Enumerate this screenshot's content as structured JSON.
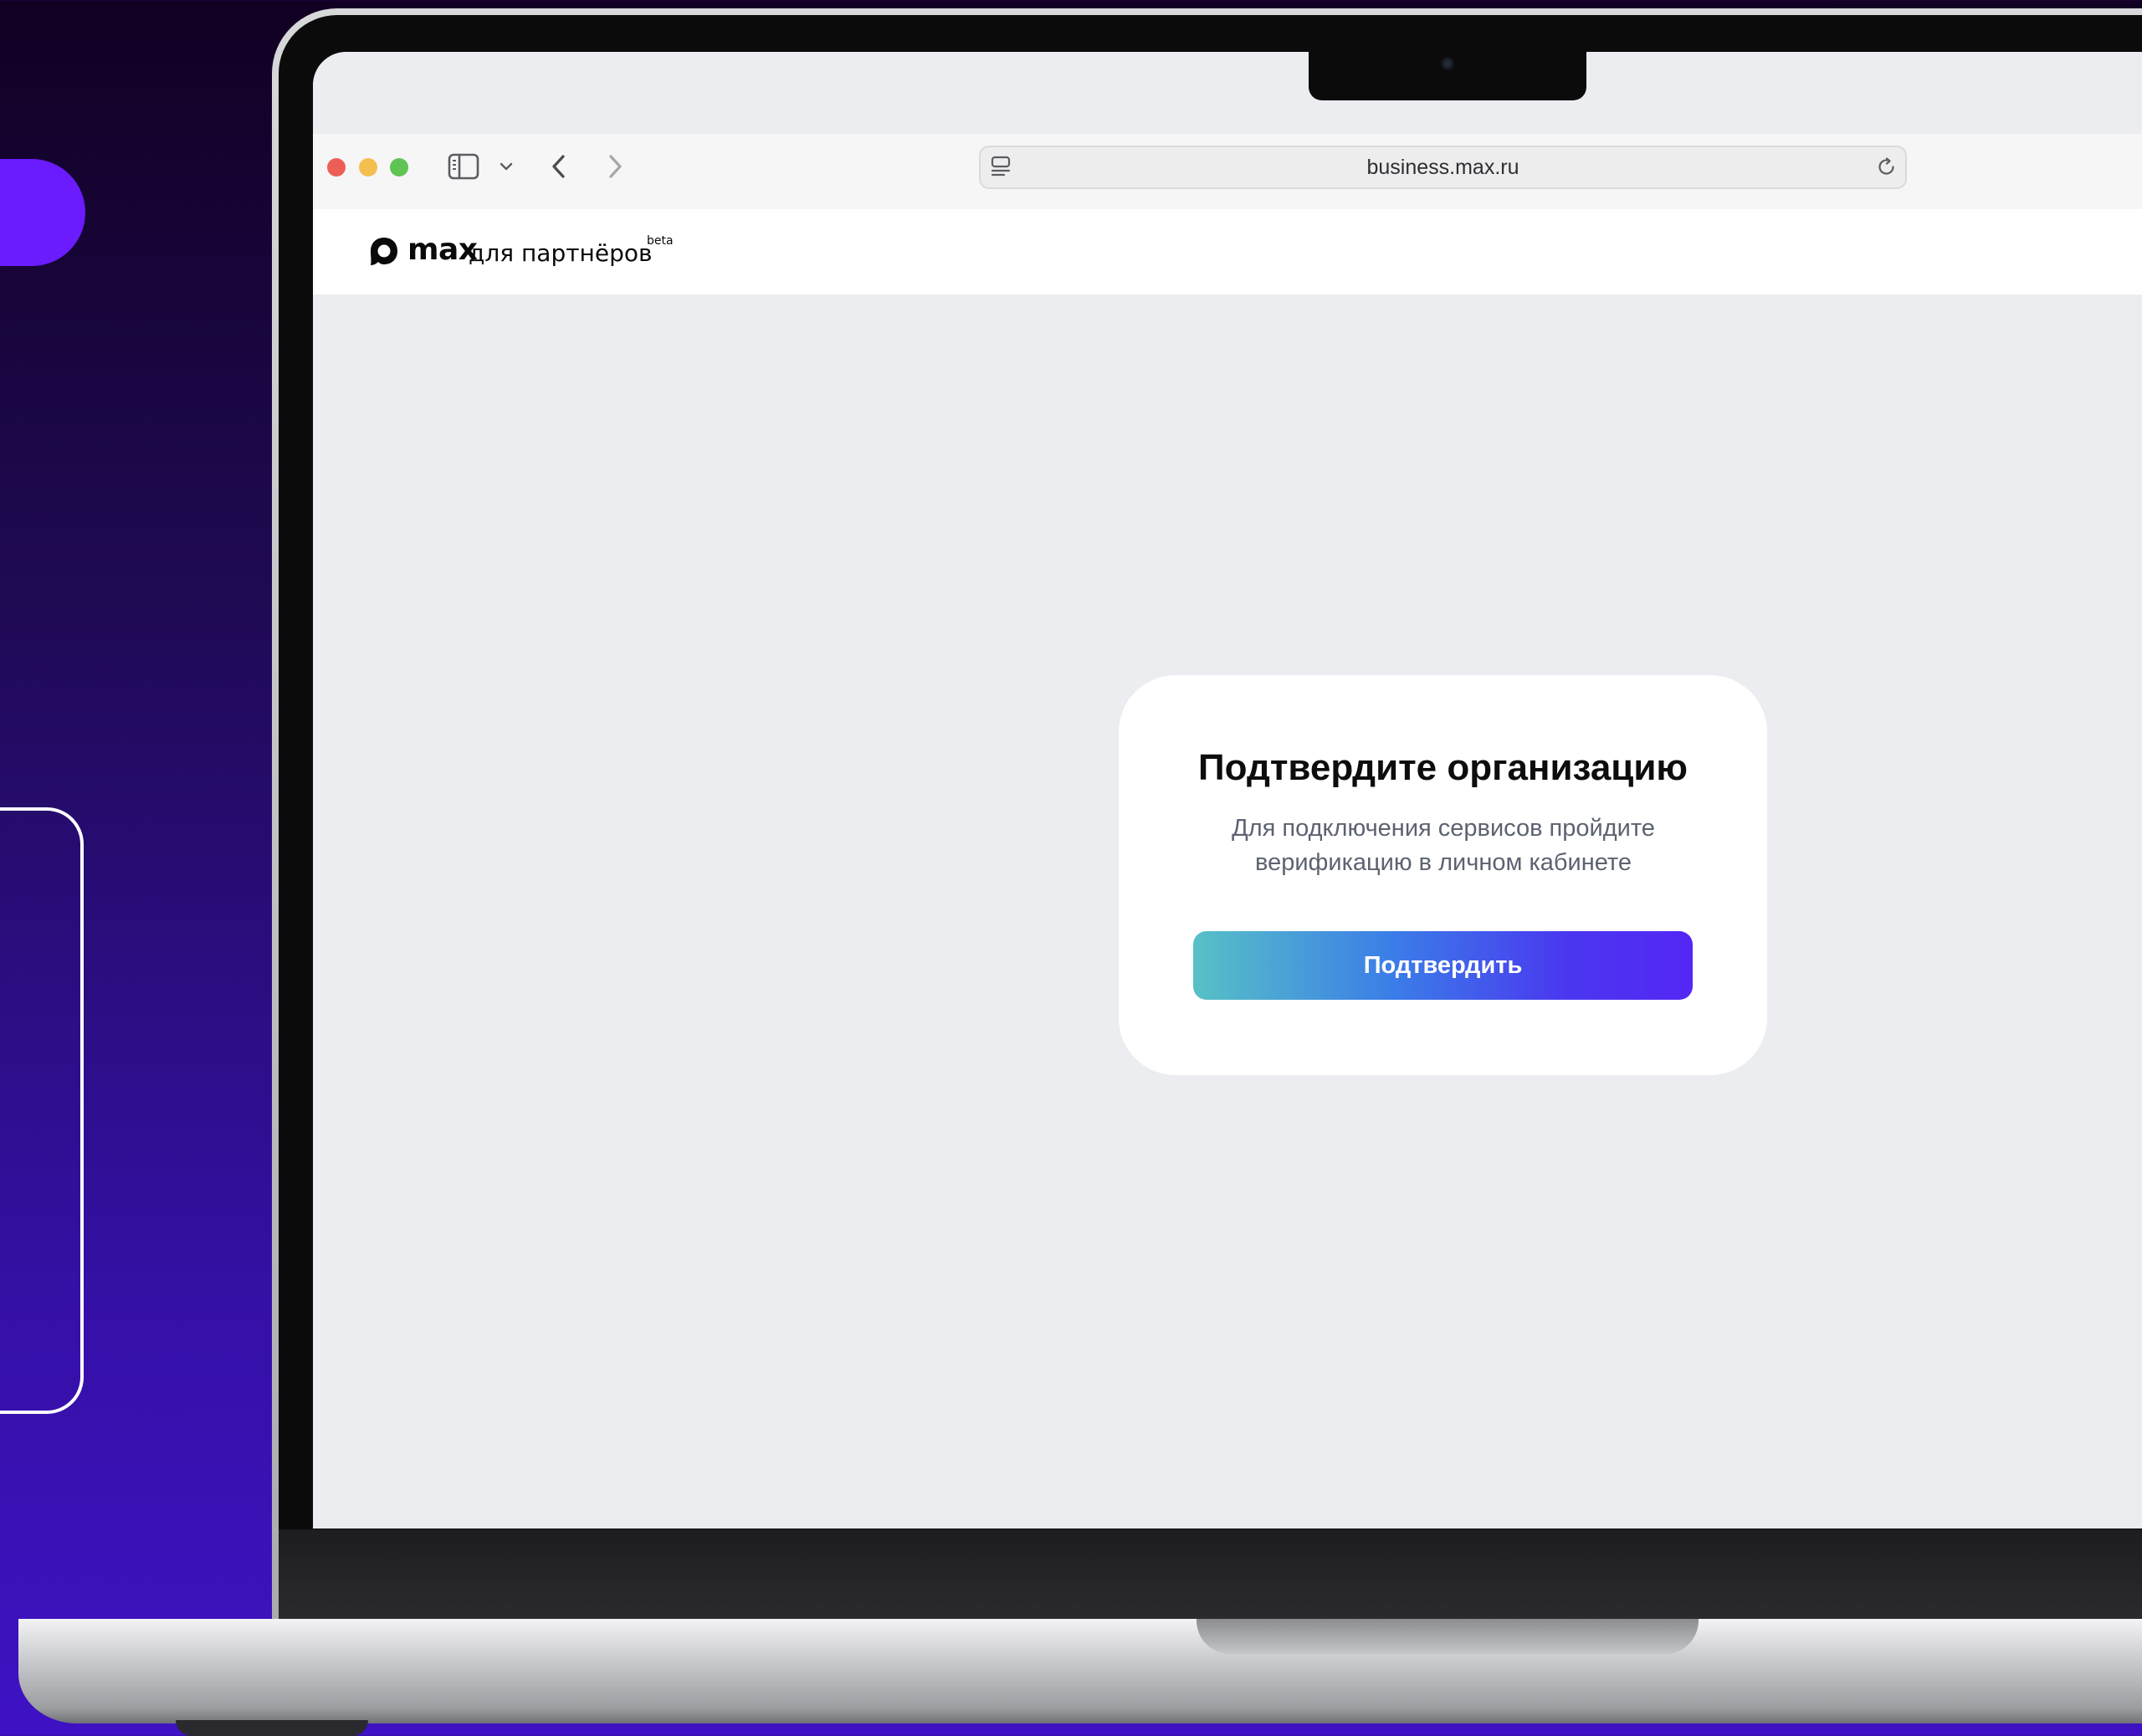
{
  "browser": {
    "url": "business.max.ru",
    "icons": {
      "sidebar": "sidebar-toggle-icon",
      "tab_overview": "chevron-down-icon",
      "back": "chevron-left-icon",
      "forward": "chevron-right-icon",
      "reader": "reader-mode-icon",
      "reload": "reload-icon"
    }
  },
  "site": {
    "logo": {
      "wordmark": "max",
      "subtitle": "для партнёров",
      "badge": "beta"
    }
  },
  "card": {
    "title": "Подтвердите организацию",
    "description_line1": "Для подключения сервисов пройдите",
    "description_line2": "верификацию в личном кабинете",
    "button_label": "Подтвердить"
  },
  "colors": {
    "background_top": "#110022",
    "background_bottom": "#3e12c4",
    "accent_purple": "#6a1cff",
    "button_gradient_start": "#57c1c6",
    "button_gradient_end": "#5427f4",
    "page_background": "#ebedf0"
  }
}
